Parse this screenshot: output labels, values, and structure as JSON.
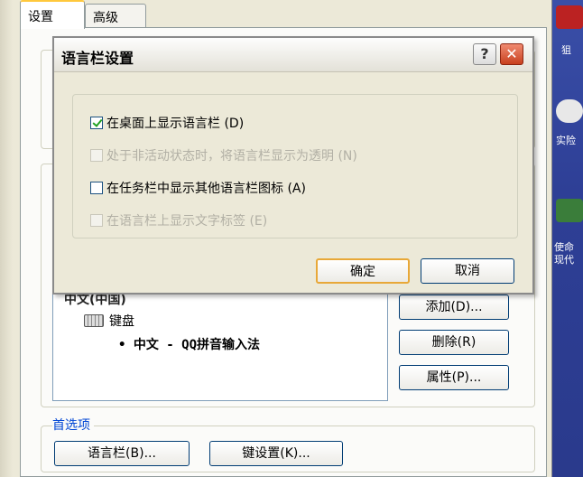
{
  "tabs": [
    {
      "label": "设置",
      "active": true
    },
    {
      "label": "高级",
      "active": false
    }
  ],
  "dialog": {
    "title": "语言栏设置",
    "help_glyph": "?",
    "close_glyph": "✕",
    "options": [
      {
        "label": "在桌面上显示语言栏 (D)",
        "checked": true,
        "enabled": true
      },
      {
        "label": "处于非活动状态时，将语言栏显示为透明 (N)",
        "checked": false,
        "enabled": false
      },
      {
        "label": "在任务栏中显示其他语言栏图标 (A)",
        "checked": false,
        "enabled": true
      },
      {
        "label": "在语言栏上显示文字标签 (E)",
        "checked": false,
        "enabled": false
      }
    ],
    "ok_label": "确定",
    "cancel_label": "取消"
  },
  "installed_services": {
    "items": [
      {
        "label": "中文(中国)"
      },
      {
        "label": "键盘"
      },
      {
        "label": "• 中文 - QQ拼音输入法"
      }
    ],
    "add_label": "添加(D)...",
    "remove_label": "删除(R)",
    "properties_label": "属性(P)..."
  },
  "preferences": {
    "title": "首选项",
    "language_bar_label": "语言栏(B)...",
    "key_settings_label": "键设置(K)..."
  },
  "desktop": {
    "labels": [
      "狙",
      "实险",
      "使命",
      "现代"
    ]
  },
  "colors": {
    "accent": "#0046d5",
    "titlebar_close": "#c8401f",
    "default_button_border": "#e8a838"
  }
}
